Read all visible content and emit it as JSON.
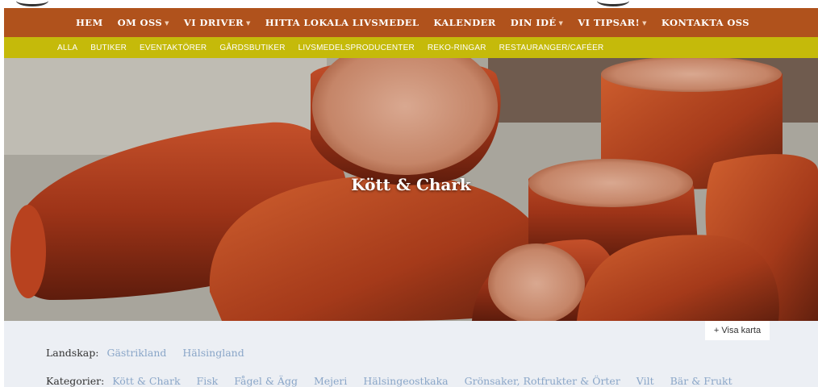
{
  "main_nav": {
    "items": [
      {
        "label": "HEM",
        "dropdown": false
      },
      {
        "label": "OM OSS",
        "dropdown": true
      },
      {
        "label": "VI DRIVER",
        "dropdown": true
      },
      {
        "label": "HITTA LOKALA LIVSMEDEL",
        "dropdown": false
      },
      {
        "label": "KALENDER",
        "dropdown": false
      },
      {
        "label": "DIN IDÉ",
        "dropdown": true
      },
      {
        "label": "VI TIPSAR!",
        "dropdown": true
      },
      {
        "label": "KONTAKTA OSS",
        "dropdown": false
      }
    ],
    "background": "#b0521c"
  },
  "sub_nav": {
    "items": [
      "ALLA",
      "BUTIKER",
      "EVENTAKTÖRER",
      "GÅRDSBUTIKER",
      "LIVSMEDELSPRODUCENTER",
      "REKO-RINGAR",
      "RESTAURANGER/CAFÉER"
    ],
    "background": "#c5ba0a"
  },
  "hero": {
    "title": "Kött & Chark",
    "image": "sausage-photo"
  },
  "filters": {
    "map_button": "+ Visa karta",
    "landskap_label": "Landskap:",
    "landskap": [
      "Gästrikland",
      "Hälsingland"
    ],
    "kategorier_label": "Kategorier:",
    "kategorier": [
      "Kött & Chark",
      "Fisk",
      "Fågel & Ägg",
      "Mejeri",
      "Hälsingeostkaka",
      "Grönsaker, Rotfrukter & Örter",
      "Vilt",
      "Bär & Frukt"
    ],
    "link_color": "#8aa6c8"
  }
}
